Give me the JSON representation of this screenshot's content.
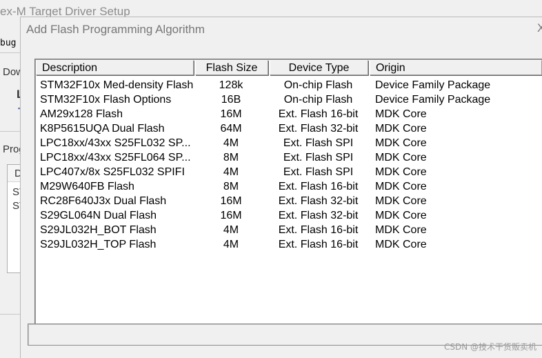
{
  "background_window": {
    "title": "ex-M Target Driver Setup",
    "menu_label": "bug",
    "frag_dow": "Dow",
    "frag_l": "L",
    "frag_prog": "Prog",
    "frag_d": "D",
    "frag_st1": "ST",
    "frag_st2": "ST"
  },
  "dialog": {
    "title": "Add Flash Programming Algorithm",
    "close_glyph": "X"
  },
  "columns": [
    "Description",
    "Flash Size",
    "Device Type",
    "Origin"
  ],
  "rows": [
    {
      "description": "STM32F10x Med-density Flash",
      "size": "128k",
      "type": "On-chip Flash",
      "origin": "Device Family Package"
    },
    {
      "description": "STM32F10x Flash Options",
      "size": "16B",
      "type": "On-chip Flash",
      "origin": "Device Family Package"
    },
    {
      "description": "AM29x128 Flash",
      "size": "16M",
      "type": "Ext. Flash 16-bit",
      "origin": "MDK Core"
    },
    {
      "description": "K8P5615UQA Dual Flash",
      "size": "64M",
      "type": "Ext. Flash 32-bit",
      "origin": "MDK Core"
    },
    {
      "description": "LPC18xx/43xx S25FL032 SP...",
      "size": "4M",
      "type": "Ext. Flash SPI",
      "origin": "MDK Core"
    },
    {
      "description": "LPC18xx/43xx S25FL064 SP...",
      "size": "8M",
      "type": "Ext. Flash SPI",
      "origin": "MDK Core"
    },
    {
      "description": "LPC407x/8x S25FL032 SPIFI",
      "size": "4M",
      "type": "Ext. Flash SPI",
      "origin": "MDK Core"
    },
    {
      "description": "M29W640FB Flash",
      "size": "8M",
      "type": "Ext. Flash 16-bit",
      "origin": "MDK Core"
    },
    {
      "description": "RC28F640J3x Dual Flash",
      "size": "16M",
      "type": "Ext. Flash 32-bit",
      "origin": "MDK Core"
    },
    {
      "description": "S29GL064N Dual Flash",
      "size": "16M",
      "type": "Ext. Flash 32-bit",
      "origin": "MDK Core"
    },
    {
      "description": "S29JL032H_BOT Flash",
      "size": "4M",
      "type": "Ext. Flash 16-bit",
      "origin": "MDK Core"
    },
    {
      "description": "S29JL032H_TOP Flash",
      "size": "4M",
      "type": "Ext. Flash 16-bit",
      "origin": "MDK Core"
    }
  ],
  "watermark": "CSDN @技术干货贩卖机"
}
